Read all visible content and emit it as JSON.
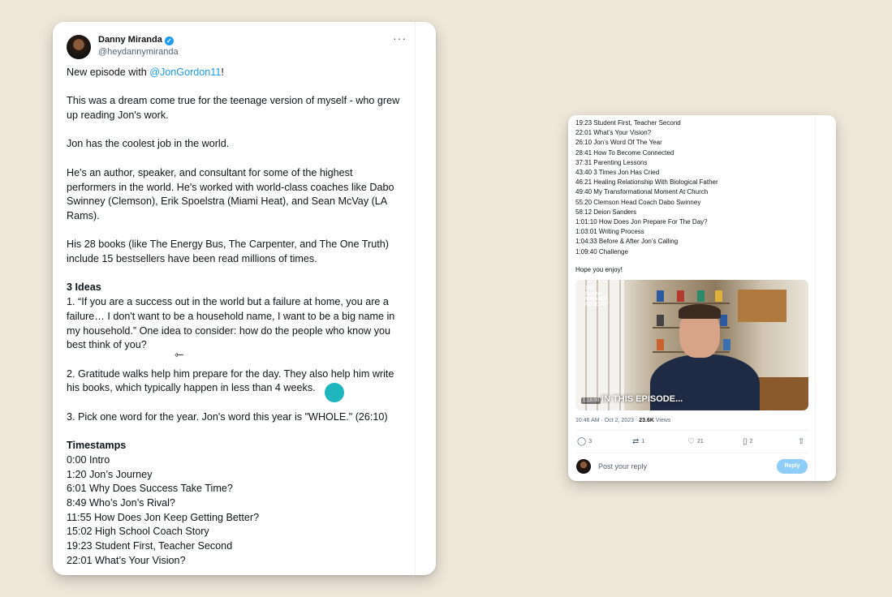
{
  "left_tweet": {
    "author_name": "Danny Miranda",
    "author_handle": "@heydannymiranda",
    "more_label": "···",
    "verified_glyph": "✓",
    "intro_prefix": "New episode with ",
    "intro_mention": "@JonGordon11",
    "intro_suffix": "!",
    "para1": [
      "This was a dream come true for the teenage version of myself - who grew",
      "up reading Jon's work."
    ],
    "para2": "Jon has the coolest job in the world.",
    "para3": [
      "He's an author, speaker, and consultant for some of the highest",
      "performers in the world. He's worked with world-class coaches like Dabo",
      "Swinney (Clemson), Erik Spoelstra (Miami Heat), and Sean McVay (LA",
      "Rams)."
    ],
    "para4": [
      "His 28 books (like The Energy Bus, The Carpenter, and The One Truth)",
      "include 15 bestsellers have been read millions of times."
    ],
    "ideas_heading": "3 Ideas",
    "idea1": [
      "1. “If you are a success out in the world but a failure at home, you are a",
      "failure… I don't want to be a household name, I want to be a big name in",
      "my household.” One idea to consider: how do the people who know you",
      "best think of you?"
    ],
    "idea2": [
      "2. Gratitude walks help him prepare for the day. They also help him write",
      "his books, which typically happen in less than 4 weeks."
    ],
    "idea3": "3. Pick one word for the year. Jon's word this year is \"WHOLE.\" (26:10)",
    "timestamps_heading": "Timestamps",
    "timestamps": [
      "0:00 Intro",
      "1:20 Jon’s Journey",
      "6:01 Why Does Success Take Time?",
      "8:49 Who’s Jon’s Rival?",
      "11:55 How Does Jon Keep Getting Better?",
      "15:02 High School Coach Story",
      "19:23 Student First, Teacher Second",
      "22:01 What’s Your Vision?"
    ],
    "cursor_glyph": "⇽"
  },
  "right_tweet": {
    "timestamps": [
      "19:23 Student First, Teacher Second",
      "22:01 What’s Your Vision?",
      "26:10 Jon’s Word Of The Year",
      "28:41 How To Become Connected",
      "37:31 Parenting Lessons",
      "43:40 3 Times Jon Has Cried",
      "46:21 Healing Relationship With Biological Father",
      "49:40 My Transformational Moment At Church",
      "55:20 Clemson Head Coach Dabo Swinney",
      "58:12 Deion Sanders",
      "1:01:10 How Does Jon Prepare For The Day?",
      "1:03:01 Writing Process",
      "1:04:33 Before & After Jon’s Calling",
      "1:09:40 Challenge"
    ],
    "closing": "Hope you enjoy!",
    "video": {
      "logo_lines": [
        "THE",
        "DANNY",
        "MIRANDA",
        "PODCAST"
      ],
      "caption": "IN THIS EPISODE...",
      "time": "1:18:00"
    },
    "meta_time": "10:46 AM · Oct 2, 2023 · ",
    "views_count": "23.6K",
    "views_label": " Views",
    "actions": {
      "replies": "3",
      "reposts": "1",
      "likes": "21",
      "bookmarks": "2"
    },
    "reply_placeholder": "Post your reply",
    "reply_button": "Reply"
  },
  "icons": {
    "reply": "◯",
    "repost": "⇄",
    "like": "♡",
    "bookmark": "▯",
    "share": "⇧"
  },
  "colors": {
    "background": "#efe8da",
    "mention": "#1d9bf0",
    "verified": "#1d9bf0",
    "click_indicator": "#1fb5bd",
    "reply_button": "#8ecdf8"
  }
}
